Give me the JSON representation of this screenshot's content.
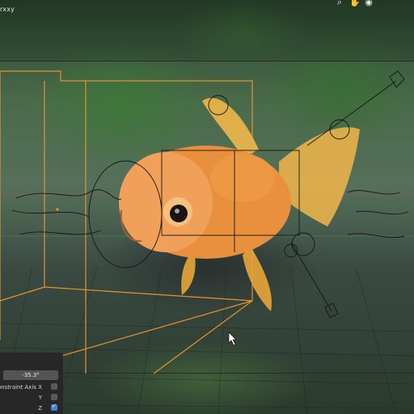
{
  "header": {
    "title": "rxxy",
    "icons": [
      "zoom-icon",
      "hand-pan-icon",
      "camera-icon"
    ]
  },
  "operator_panel": {
    "rotation_value": "-35.3°",
    "constraint_axis_label": "Constraint Axis X",
    "axis_y_label": "Y",
    "axis_z_label": "Z",
    "axis_x_checked": false,
    "axis_y_checked": false,
    "axis_z_checked": true
  },
  "colors": {
    "selection_outline": "#e8922a",
    "axis_x_red": "#ff3a3a",
    "axis_y_green": "#3aff5a",
    "fish_orange": "#e58a3a",
    "checkbox_blue": "#4a7fd0"
  }
}
